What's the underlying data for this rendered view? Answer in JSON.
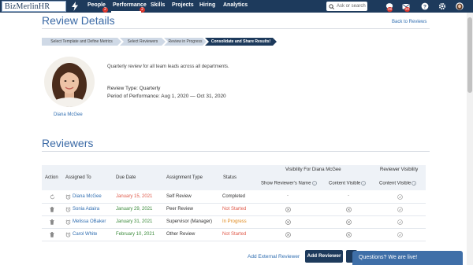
{
  "app": {
    "logo_text": "BizMerlinHR"
  },
  "nav": {
    "items": [
      {
        "label": "People",
        "badge": "2"
      },
      {
        "label": "Performance",
        "badge": "2"
      },
      {
        "label": "Skills"
      },
      {
        "label": "Projects"
      },
      {
        "label": "Hiring"
      },
      {
        "label": "Analytics"
      }
    ],
    "search_placeholder": "Ask or search",
    "badges": {
      "messages": "28",
      "mail": "20"
    }
  },
  "header": {
    "title": "Review Details",
    "back_link": "Back to Reviews"
  },
  "steps": [
    {
      "label": "Select Template and Define Metrics",
      "active": false
    },
    {
      "label": "Select Reviewers",
      "active": false
    },
    {
      "label": "Review in Progress",
      "active": false
    },
    {
      "label": "Consolidate and Share Results!",
      "active": true
    }
  ],
  "profile": {
    "name": "Diana McGee",
    "description": "Quarterly review for all team leads across all departments.",
    "review_type": "Review Type: Quarterly",
    "period": "Period of Performance: Aug 1, 2020 — Oct 31, 2020"
  },
  "reviewers": {
    "section_title": "Reviewers",
    "headers": {
      "action": "Action",
      "assigned_to": "Assigned To",
      "due_date": "Due Date",
      "assignment_type": "Assignment Type",
      "status": "Status",
      "visibility_group": "Visibility For Diana McGee",
      "show_name": "Show Reviewer's Name",
      "content_visible": "Content Visible",
      "reviewer_visibility": "Reviewer Visibility",
      "content_visible_2": "Content Visible"
    },
    "rows": [
      {
        "name": "Diana McGee",
        "due": "January 15, 2021",
        "due_color": "red",
        "type": "Self Review",
        "status": "Completed",
        "status_kind": "done",
        "show_name": "-",
        "content": "-",
        "rv_content": "check"
      },
      {
        "name": "Sonia Adaira",
        "due": "January 29, 2021",
        "due_color": "green",
        "type": "Peer Review",
        "status": "Not Started",
        "status_kind": "not",
        "show_name": "x",
        "content": "x",
        "rv_content": "check"
      },
      {
        "name": "Melissa OBaker",
        "due": "January 31, 2021",
        "due_color": "green",
        "type": "Supervisor (Manager)",
        "status": "In Progress",
        "status_kind": "prog",
        "show_name": "x",
        "content": "x",
        "rv_content": "check"
      },
      {
        "name": "Carol White",
        "due": "February 10, 2021",
        "due_color": "green",
        "type": "Other Review",
        "status": "Not Started",
        "status_kind": "not",
        "show_name": "x",
        "content": "x",
        "rv_content": "check"
      }
    ]
  },
  "actions": {
    "add_external": "Add External Reviewer",
    "add_reviewer": "Add Reviewer"
  },
  "chat": {
    "label": "Questions? We are live!"
  },
  "colors": {
    "nav_bg": "#1d3a5c",
    "accent": "#3b6aa6",
    "link": "#2f6db0",
    "danger": "#e05a4a",
    "success": "#3a8a3a",
    "warning": "#e08a1e"
  }
}
